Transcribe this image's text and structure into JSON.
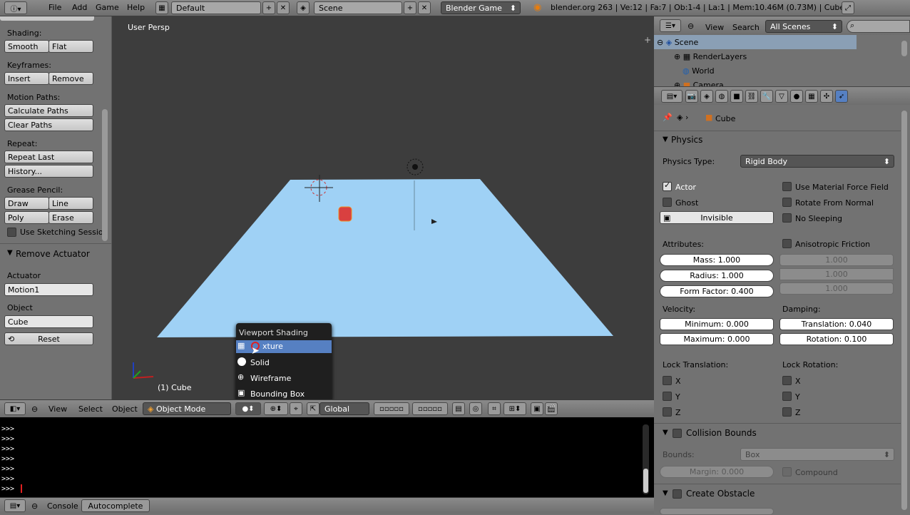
{
  "topbar": {
    "menus": [
      "File",
      "Add",
      "Game",
      "Help"
    ],
    "screen_layout": "Default",
    "scene": "Scene",
    "engine": "Blender Game",
    "info": "blender.org 263 | Ve:12 | Fa:7 | Ob:1-4 | La:1 | Mem:10.46M (0.73M) | Cube"
  },
  "toolshelf": {
    "shading_label": "Shading:",
    "smooth": "Smooth",
    "flat": "Flat",
    "keyframes_label": "Keyframes:",
    "insert": "Insert",
    "remove": "Remove",
    "motion_label": "Motion Paths:",
    "calc_paths": "Calculate Paths",
    "clear_paths": "Clear Paths",
    "repeat_label": "Repeat:",
    "repeat_last": "Repeat Last",
    "history": "History...",
    "grease_label": "Grease Pencil:",
    "draw": "Draw",
    "line": "Line",
    "poly": "Poly",
    "erase": "Erase",
    "sketching": "Use Sketching Sessio",
    "remove_actuator": "Remove Actuator",
    "actuator_label": "Actuator",
    "actuator_value": "Motion1",
    "object_label": "Object",
    "object_value": "Cube",
    "reset": "Reset"
  },
  "viewport": {
    "view_name": "User Persp",
    "object_name": "(1) Cube"
  },
  "shading_menu": {
    "title": "Viewport Shading",
    "items": [
      "Texture",
      "Solid",
      "Wireframe",
      "Bounding Box"
    ],
    "texture_visible": "xture"
  },
  "vheader": {
    "view": "View",
    "select": "Select",
    "object": "Object",
    "mode": "Object Mode",
    "orientation": "Global"
  },
  "console": {
    "prompt": ">>>",
    "footer_console": "Console",
    "footer_autocomplete": "Autocomplete"
  },
  "outliner": {
    "view": "View",
    "search": "Search",
    "filter": "All Scenes",
    "rows": [
      "Scene",
      "RenderLayers",
      "World",
      "Camera"
    ]
  },
  "properties": {
    "breadcrumb": "Cube",
    "physics_title": "Physics",
    "physics_type_label": "Physics Type:",
    "physics_type": "Rigid Body",
    "actor": "Actor",
    "ghost": "Ghost",
    "invisible": "Invisible",
    "use_material_force": "Use Material Force Field",
    "rotate_from_normal": "Rotate From Normal",
    "no_sleeping": "No Sleeping",
    "attributes_label": "Attributes:",
    "mass": "Mass: 1.000",
    "radius": "Radius: 1.000",
    "form_factor": "Form Factor: 0.400",
    "anisotropic": "Anisotropic Friction",
    "aniso_x": "1.000",
    "aniso_y": "1.000",
    "aniso_z": "1.000",
    "velocity_label": "Velocity:",
    "minimum": "Minimum: 0.000",
    "maximum": "Maximum: 0.000",
    "damping_label": "Damping:",
    "translation": "Translation: 0.040",
    "rotation": "Rotation: 0.100",
    "lock_translation": "Lock Translation:",
    "lock_rotation": "Lock Rotation:",
    "x": "X",
    "y": "Y",
    "z": "Z",
    "collision_bounds": "Collision Bounds",
    "bounds_label": "Bounds:",
    "bounds_value": "Box",
    "margin": "Margin: 0.000",
    "compound": "Compound",
    "create_obstacle": "Create Obstacle"
  },
  "colors": {
    "plane": "#9fd1f5",
    "viewport_bg": "#3d3d3d",
    "selection": "#5680c2"
  }
}
